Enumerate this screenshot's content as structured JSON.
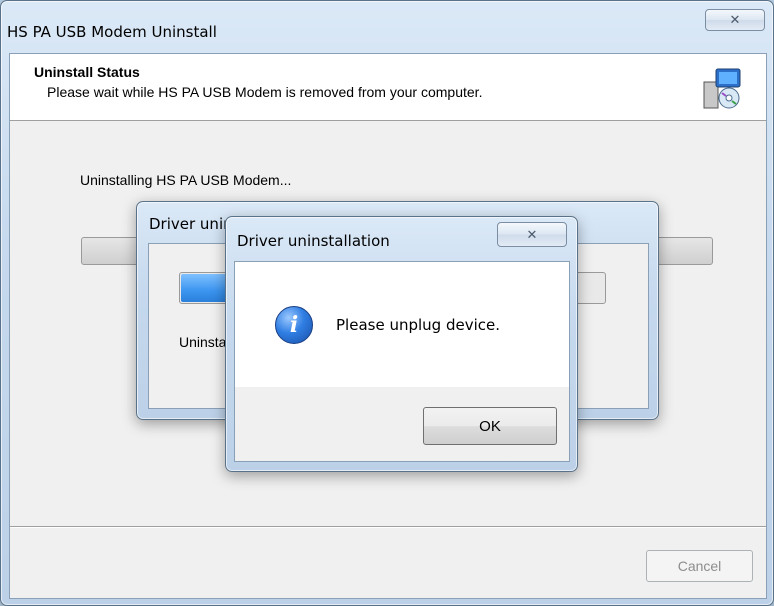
{
  "main_window": {
    "title": "HS PA USB Modem Uninstall",
    "close_glyph": "✕",
    "header_title": "Uninstall Status",
    "header_subtitle": "Please wait while HS PA USB Modem is removed from your computer.",
    "status_text": "Uninstalling HS PA USB Modem...",
    "cancel_label": "Cancel",
    "installer_icon": "installer-computer-disc-icon"
  },
  "middle_dialog": {
    "title": "Driver uninstallation",
    "progress_fraction": 0.25,
    "status_text": "Uninstalling driver"
  },
  "front_dialog": {
    "title": "Driver uninstallation",
    "close_glyph": "✕",
    "message": "Please unplug device.",
    "icon": "info-icon",
    "ok_label": "OK"
  },
  "colors": {
    "progress_fill": "#3c95f0",
    "info_icon_blue": "#2f7ee3"
  }
}
